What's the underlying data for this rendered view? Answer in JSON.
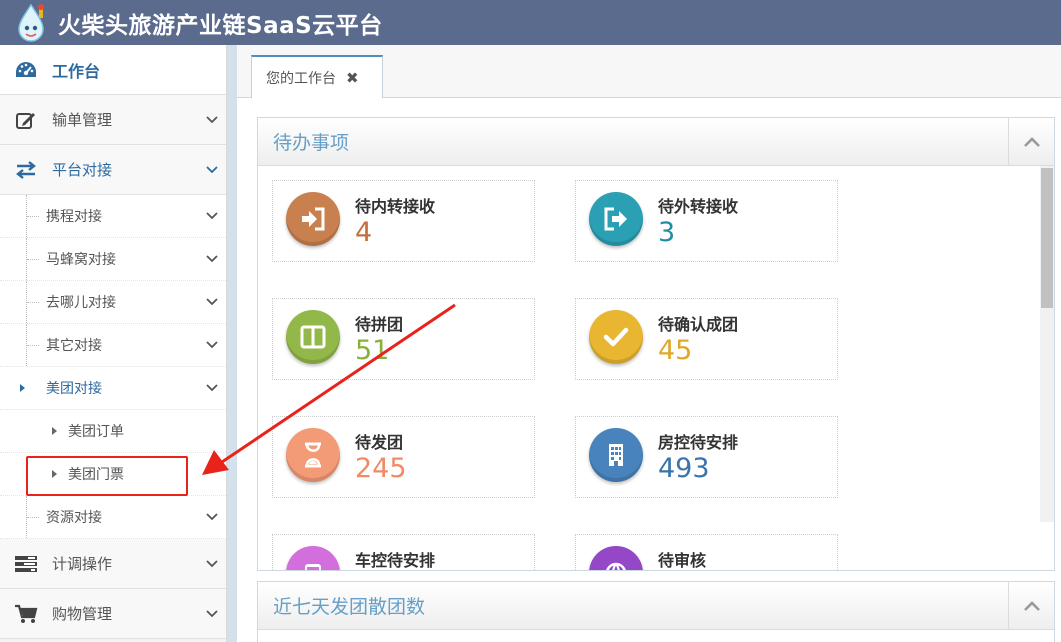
{
  "header": {
    "title": "火柴头旅游产业链SaaS云平台"
  },
  "sidebar": {
    "dashboard": {
      "label": "工作台",
      "icon": "dashboard-icon"
    },
    "items": [
      {
        "label": "输单管理",
        "icon": "edit-icon"
      },
      {
        "label": "平台对接",
        "icon": "exchange-icon"
      },
      {
        "label": "计调操作",
        "icon": "tasks-icon"
      },
      {
        "label": "购物管理",
        "icon": "cart-icon"
      }
    ],
    "sub_items": [
      {
        "label": "携程对接"
      },
      {
        "label": "马蜂窝对接"
      },
      {
        "label": "去哪儿对接"
      },
      {
        "label": "其它对接"
      },
      {
        "label": "美团对接"
      },
      {
        "label": "资源对接"
      }
    ],
    "meituan_children": [
      {
        "label": "美团订单"
      },
      {
        "label": "美团门票"
      }
    ]
  },
  "tabs": [
    {
      "label": "您的工作台",
      "close": "✖"
    }
  ],
  "todo_panel": {
    "title": "待办事项",
    "stats": [
      {
        "label": "待内转接收",
        "value": "4",
        "color": "#c56e3c",
        "icon": "sign-in-icon"
      },
      {
        "label": "待外转接收",
        "value": "3",
        "color": "#1e8fa3",
        "icon": "sign-out-icon"
      },
      {
        "label": "待拼团",
        "value": "51",
        "color": "#8ab03c",
        "icon": "columns-icon"
      },
      {
        "label": "待确认成团",
        "value": "45",
        "color": "#e0a82a",
        "icon": "check-icon"
      },
      {
        "label": "待发团",
        "value": "245",
        "color": "#f08b65",
        "icon": "hourglass-icon"
      },
      {
        "label": "房控待安排",
        "value": "493",
        "color": "#3a73ad",
        "icon": "building-icon"
      },
      {
        "label": "车控待安排",
        "value": "",
        "color": "#c25fcc",
        "icon": "bus-icon"
      },
      {
        "label": "待审核",
        "value": "",
        "color": "#8a3fc0",
        "icon": "globe-icon"
      }
    ]
  },
  "week_panel": {
    "title": "近七天发团散团数"
  },
  "colors": {
    "header_bg": "#5a6b8e",
    "accent": "#2c6aa0",
    "annotation": "#e8231b"
  }
}
